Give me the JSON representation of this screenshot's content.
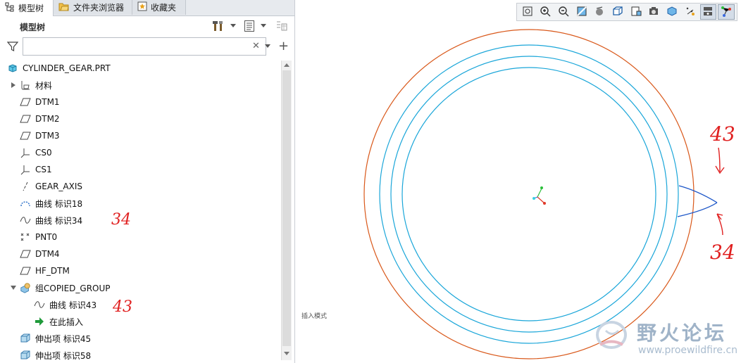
{
  "tabs": [
    {
      "label": "模型树",
      "icon": "model-tree-icon",
      "active": true
    },
    {
      "label": "文件夹浏览器",
      "icon": "folder-browser-icon",
      "active": false
    },
    {
      "label": "收藏夹",
      "icon": "favorites-icon",
      "active": false
    }
  ],
  "panel": {
    "title": "模型树",
    "search_value": ""
  },
  "tree": [
    {
      "label": "CYLINDER_GEAR.PRT",
      "icon": "part-icon"
    },
    {
      "label": "材料",
      "icon": "material-icon",
      "expandable": true
    },
    {
      "label": "DTM1",
      "icon": "datum-plane-icon"
    },
    {
      "label": "DTM2",
      "icon": "datum-plane-icon"
    },
    {
      "label": "DTM3",
      "icon": "datum-plane-icon"
    },
    {
      "label": "CS0",
      "icon": "coordinate-system-icon"
    },
    {
      "label": "CS1",
      "icon": "coordinate-system-icon"
    },
    {
      "label": "GEAR_AXIS",
      "icon": "axis-icon"
    },
    {
      "label": "曲线 标识18",
      "icon": "curve-icon"
    },
    {
      "label": "曲线 标识34",
      "icon": "sketch-curve-icon"
    },
    {
      "label": "PNT0",
      "icon": "datum-point-icon"
    },
    {
      "label": "DTM4",
      "icon": "datum-plane-icon"
    },
    {
      "label": "HF_DTM",
      "icon": "datum-plane-icon"
    },
    {
      "label": "组COPIED_GROUP",
      "icon": "group-icon",
      "expandable": true,
      "expanded": true
    },
    {
      "label": "曲线 标识43",
      "icon": "sketch-curve-icon",
      "indent": 1
    },
    {
      "label": "在此插入",
      "icon": "insert-here-icon",
      "indent": 1
    },
    {
      "label": "伸出项 标识45",
      "icon": "extrude-icon"
    },
    {
      "label": "伸出项 标识58",
      "icon": "extrude-icon"
    }
  ],
  "annotations": {
    "tree_34": "34",
    "tree_43": "43",
    "view_43": "43",
    "view_34": "34"
  },
  "view_toolbar": [
    "refit-icon",
    "zoom-in-icon",
    "zoom-out-icon",
    "repaint-icon",
    "display-style-icon",
    "saved-view-icon",
    "view-manager-icon",
    "perspective-icon",
    "annotation-display-icon",
    "datum-display-icon",
    "spin-center-icon",
    "model-display-icon",
    "sketch-view-icon"
  ],
  "graphics": {
    "mode_label": "插入模式",
    "colors": {
      "outer_circle": "#d9581a",
      "inner_circles": "#1aa6d9",
      "tooth_curve": "#1c56c8",
      "annotation": "#e02020"
    }
  },
  "watermark": {
    "title": "野火论坛",
    "url": "www.proewildfire.cn"
  }
}
